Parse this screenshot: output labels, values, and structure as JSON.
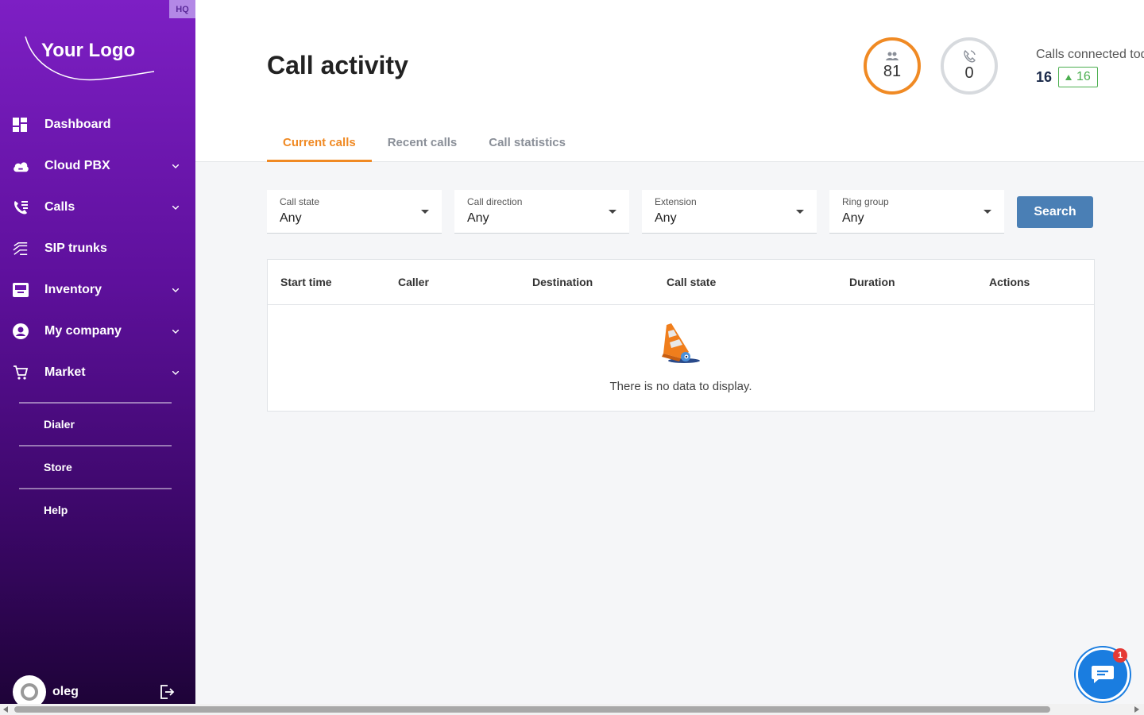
{
  "sidebar": {
    "hq_badge": "HQ",
    "logo_text": "Your Logo",
    "items": [
      {
        "label": "Dashboard",
        "icon": "dashboard-icon",
        "has_chevron": false
      },
      {
        "label": "Cloud PBX",
        "icon": "cloud-icon",
        "has_chevron": true
      },
      {
        "label": "Calls",
        "icon": "phone-list-icon",
        "has_chevron": true
      },
      {
        "label": "SIP trunks",
        "icon": "sip-trunks-icon",
        "has_chevron": false
      },
      {
        "label": "Inventory",
        "icon": "inventory-icon",
        "has_chevron": true
      },
      {
        "label": "My company",
        "icon": "account-circle-icon",
        "has_chevron": true
      },
      {
        "label": "Market",
        "icon": "cart-icon",
        "has_chevron": true
      }
    ],
    "sub_items": [
      {
        "label": "Dialer"
      },
      {
        "label": "Store"
      },
      {
        "label": "Help"
      }
    ],
    "user": {
      "name": "oleg"
    }
  },
  "header": {
    "title": "Call activity",
    "stats": {
      "users_count": "81",
      "calls_count": "0",
      "today_label": "Calls connected today",
      "today_value": "16",
      "today_change": "16",
      "accent_color": "#f08a24"
    },
    "tabs": [
      {
        "label": "Current calls",
        "active": true
      },
      {
        "label": "Recent calls",
        "active": false
      },
      {
        "label": "Call statistics",
        "active": false
      }
    ]
  },
  "filters": [
    {
      "label": "Call state",
      "value": "Any"
    },
    {
      "label": "Call direction",
      "value": "Any"
    },
    {
      "label": "Extension",
      "value": "Any"
    },
    {
      "label": "Ring group",
      "value": "Any"
    }
  ],
  "search_label": "Search",
  "table": {
    "columns": [
      "Start time",
      "Caller",
      "Destination",
      "Call state",
      "Duration",
      "Actions"
    ],
    "empty_text": "There is no data to display."
  },
  "chat": {
    "badge": "1"
  }
}
